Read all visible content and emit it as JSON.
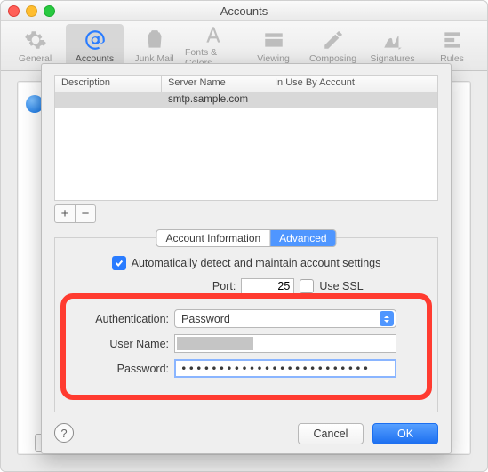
{
  "window": {
    "title": "Accounts"
  },
  "toolbar": {
    "items": [
      {
        "id": "general",
        "label": "General"
      },
      {
        "id": "accounts",
        "label": "Accounts",
        "selected": true
      },
      {
        "id": "junk",
        "label": "Junk Mail"
      },
      {
        "id": "fonts",
        "label": "Fonts & Colors"
      },
      {
        "id": "viewing",
        "label": "Viewing"
      },
      {
        "id": "composing",
        "label": "Composing"
      },
      {
        "id": "signatures",
        "label": "Signatures"
      },
      {
        "id": "rules",
        "label": "Rules"
      }
    ]
  },
  "sheet": {
    "table": {
      "headers": {
        "description": "Description",
        "server": "Server Name",
        "inuse": "In Use By Account"
      },
      "rows": [
        {
          "description": "",
          "server": "smtp.sample.com",
          "inuse": ""
        }
      ]
    },
    "tabs": {
      "info": "Account Information",
      "advanced": "Advanced",
      "selected": "advanced"
    },
    "settings": {
      "auto_detect_label": "Automatically detect and maintain account settings",
      "auto_detect_checked": true,
      "port_label": "Port:",
      "port_value": "25",
      "use_ssl_label": "Use SSL",
      "use_ssl_checked": false,
      "auth_label": "Authentication:",
      "auth_value": "Password",
      "user_label": "User Name:",
      "user_value": "",
      "pass_label": "Password:",
      "pass_value": "•••••••••••••••••••••••••"
    },
    "buttons": {
      "cancel": "Cancel",
      "ok": "OK",
      "help": "?"
    },
    "plusminus": {
      "plus": "+",
      "minus": "−"
    }
  }
}
